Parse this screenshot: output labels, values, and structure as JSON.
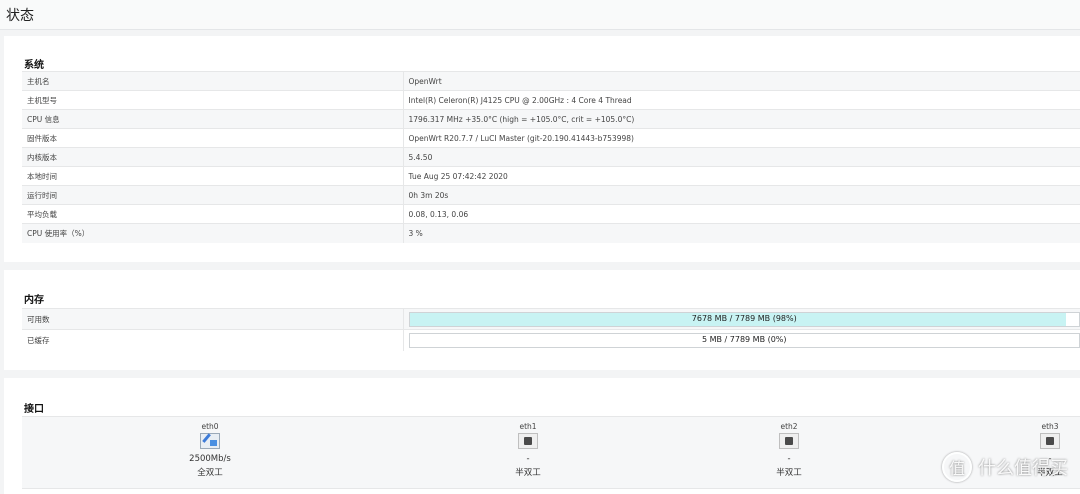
{
  "page": {
    "title": "状态"
  },
  "system": {
    "title": "系统",
    "rows": [
      {
        "key": "主机名",
        "value": "OpenWrt"
      },
      {
        "key": "主机型号",
        "value": "Intel(R) Celeron(R) J4125 CPU @ 2.00GHz : 4 Core 4 Thread"
      },
      {
        "key": "CPU 信息",
        "value": "1796.317 MHz +35.0°C (high = +105.0°C, crit = +105.0°C)"
      },
      {
        "key": "固件版本",
        "value": "OpenWrt R20.7.7 / LuCI Master (git-20.190.41443-b753998)"
      },
      {
        "key": "内核版本",
        "value": "5.4.50"
      },
      {
        "key": "本地时间",
        "value": "Tue Aug 25 07:42:42 2020"
      },
      {
        "key": "运行时间",
        "value": "0h 3m 20s"
      },
      {
        "key": "平均负载",
        "value": "0.08, 0.13, 0.06"
      },
      {
        "key": "CPU 使用率（%）",
        "value": "3 %"
      }
    ]
  },
  "memory": {
    "title": "内存",
    "rows": [
      {
        "key": "可用数",
        "text": "7678 MB / 7789 MB (98%)",
        "percent": 98,
        "fill_color": "#c8f3f3"
      },
      {
        "key": "已缓存",
        "text": "5 MB / 7789 MB (0%)",
        "percent": 0,
        "fill_color": "#c8f3f3"
      }
    ]
  },
  "network": {
    "title": "接口",
    "ports": [
      {
        "name": "eth0",
        "icon": "ethernet-port-connected-icon",
        "speed": "2500Mb/s",
        "duplex": "全双工"
      },
      {
        "name": "eth1",
        "icon": "ethernet-port-icon",
        "speed": "-",
        "duplex": "半双工"
      },
      {
        "name": "eth2",
        "icon": "ethernet-port-icon",
        "speed": "-",
        "duplex": "半双工"
      },
      {
        "name": "eth3",
        "icon": "ethernet-port-icon",
        "speed": "-",
        "duplex": "半双工"
      }
    ]
  },
  "watermark": {
    "logo": "值",
    "text": "什么值得买"
  }
}
